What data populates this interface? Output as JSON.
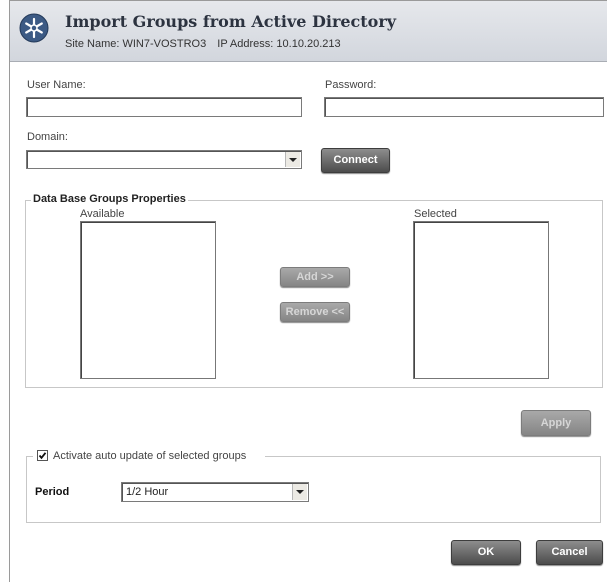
{
  "header": {
    "title": "Import Groups from Active Directory",
    "site_label": "Site Name:",
    "site_name": "WIN7-VOSTRO3",
    "ip_label": "IP Address:",
    "ip_address": "10.10.20.213"
  },
  "credentials": {
    "username_label": "User Name:",
    "username_value": "",
    "password_label": "Password:",
    "password_value": "",
    "domain_label": "Domain:",
    "domain_value": "",
    "connect_label": "Connect"
  },
  "groups": {
    "legend": "Data Base Groups Properties",
    "available_label": "Available",
    "selected_label": "Selected",
    "available_items": [],
    "selected_items": [],
    "add_label": "Add >>",
    "remove_label": "Remove <<"
  },
  "apply_label": "Apply",
  "auto_update": {
    "checkbox_label": "Activate auto update of selected groups",
    "checked": true,
    "period_label": "Period",
    "period_value": "1/2 Hour"
  },
  "footer": {
    "ok_label": "OK",
    "cancel_label": "Cancel"
  },
  "icons": {
    "logo": "snowflake-logo-icon",
    "dropdown": "chevron-down-icon",
    "check": "check-icon"
  },
  "colors": {
    "header_bg": "#d8dce2",
    "button_dark": "#5a5a5a",
    "button_disabled": "#9a9a9a"
  }
}
